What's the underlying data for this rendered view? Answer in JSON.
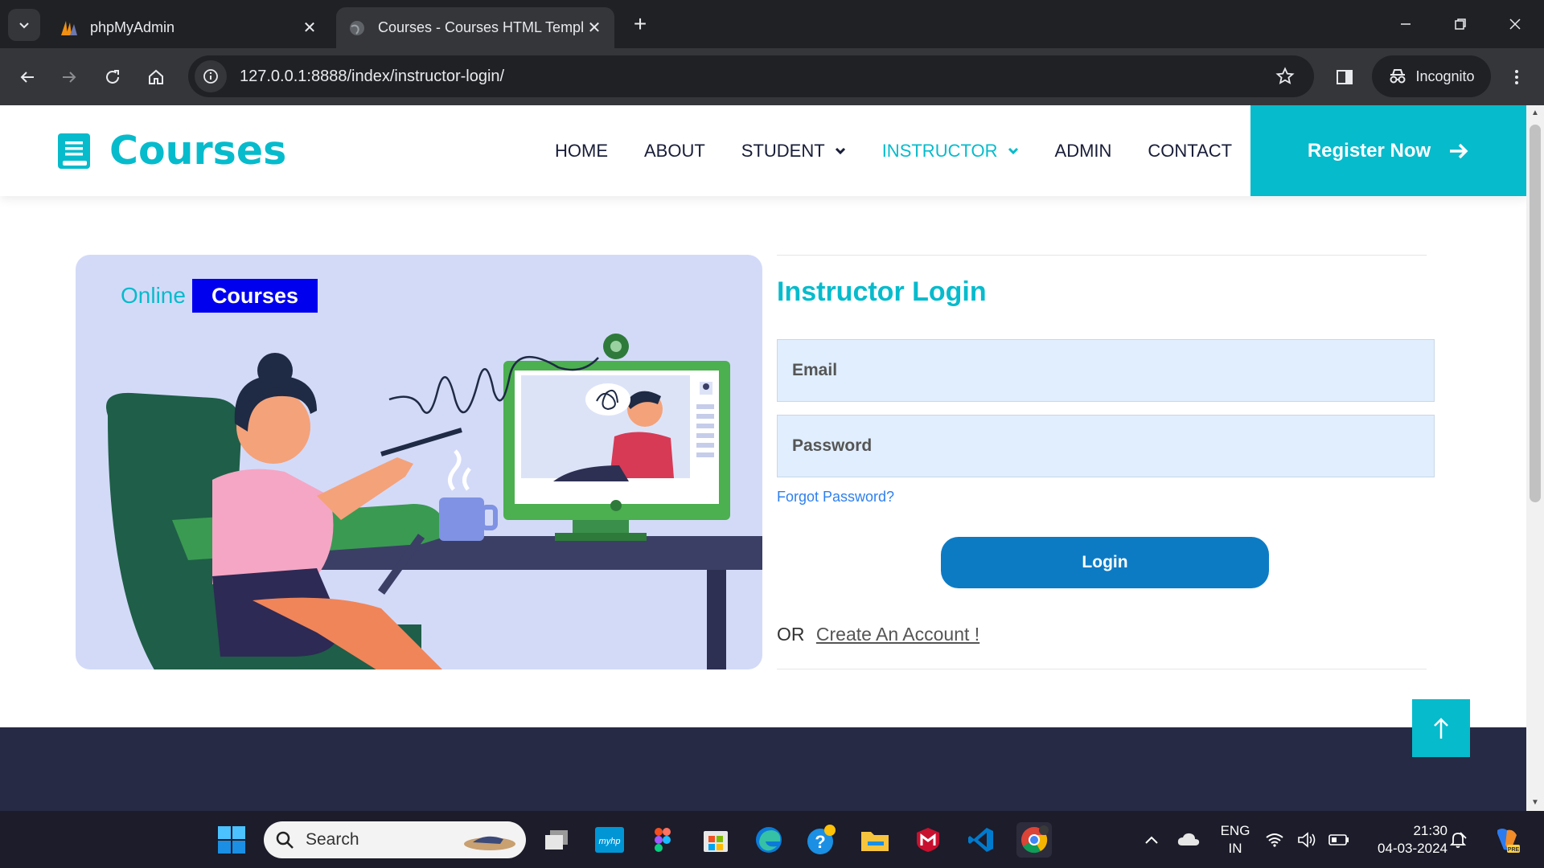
{
  "browser": {
    "tabs": [
      {
        "title": "phpMyAdmin",
        "active": false
      },
      {
        "title": "Courses - Courses HTML Templ",
        "active": true
      }
    ],
    "url": "127.0.0.1:8888/index/instructor-login/",
    "incognito_label": "Incognito"
  },
  "site": {
    "logo_text": "Courses",
    "brand_color": "#06bbcc",
    "nav": [
      {
        "label": "HOME",
        "dropdown": false,
        "active": false
      },
      {
        "label": "ABOUT",
        "dropdown": false,
        "active": false
      },
      {
        "label": "STUDENT",
        "dropdown": true,
        "active": false
      },
      {
        "label": "INSTRUCTOR",
        "dropdown": true,
        "active": true
      },
      {
        "label": "ADMIN",
        "dropdown": false,
        "active": false
      },
      {
        "label": "CONTACT",
        "dropdown": false,
        "active": false
      }
    ],
    "register_label": "Register Now"
  },
  "hero": {
    "badge_online": "Online",
    "badge_courses": "Courses"
  },
  "login": {
    "title": "Instructor Login",
    "email_placeholder": "Email",
    "password_placeholder": "Password",
    "forgot_label": "Forgot Password?",
    "button_label": "Login",
    "or_label": "OR",
    "create_label": "Create An Account !"
  },
  "taskbar": {
    "search_placeholder": "Search",
    "lang_top": "ENG",
    "lang_bottom": "IN",
    "time": "21:30",
    "date": "04-03-2024"
  }
}
